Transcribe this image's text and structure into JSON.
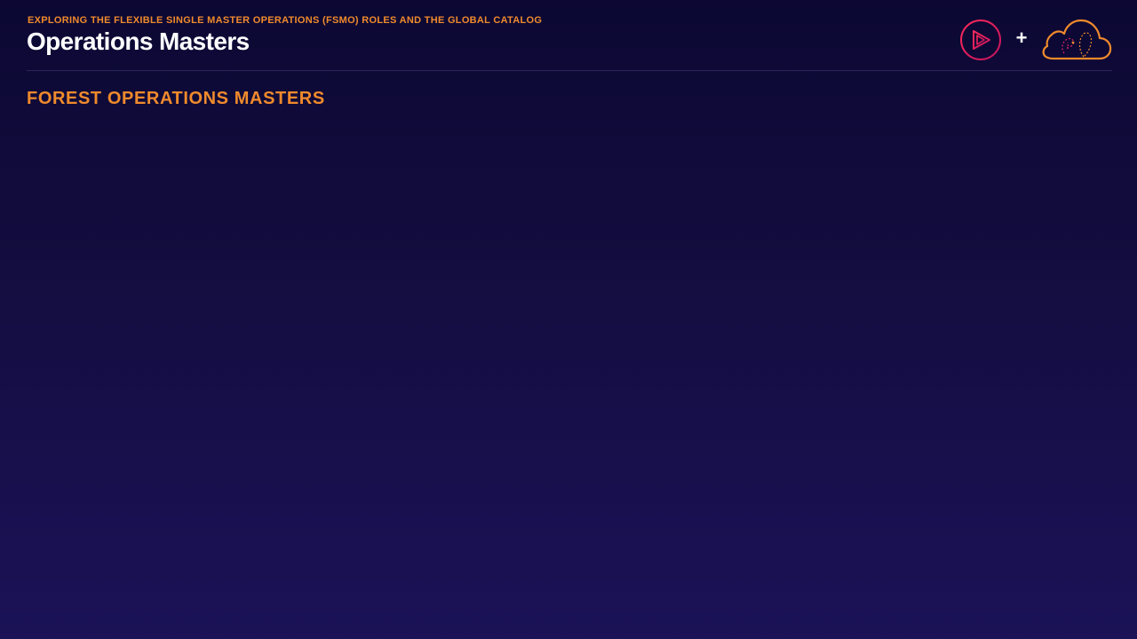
{
  "header": {
    "kicker": "EXPLORING THE FLEXIBLE SINGLE MASTER OPERATIONS (FSMO) ROLES AND THE GLOBAL CATALOG",
    "title": "Operations Masters",
    "logos": {
      "play_icon": "play-circle-logo",
      "plus": "+",
      "cloud_icon": "cloud-guru-logo"
    }
  },
  "section": {
    "heading": "FOREST OPERATIONS MASTERS"
  },
  "colors": {
    "accent_orange": "#f08a2c",
    "play_red": "#e0225f",
    "background_top": "#0c0833",
    "background_bottom": "#1b1257",
    "title_white": "#ffffff"
  }
}
